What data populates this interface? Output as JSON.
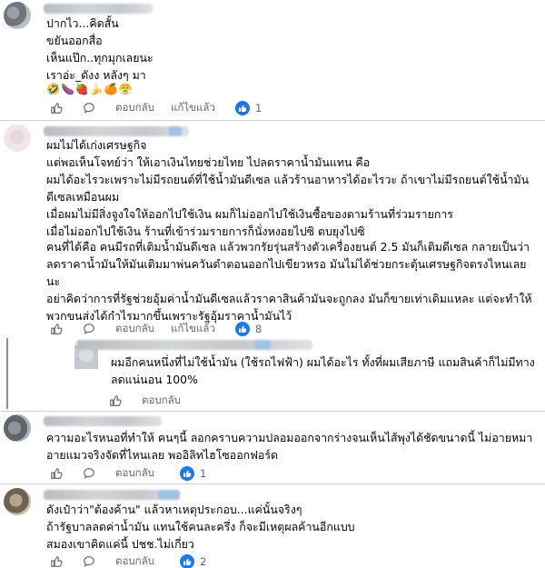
{
  "comments": [
    {
      "text": "ปากไว...คิดสั้น\nขยันออกสื่อ\nเห็นแป๊ก..ทุกมุกเลยนะ\nเราอ่ะ_ดังง หลังๆ มา",
      "emoji": "🤣🍆🍓🍌🍊😤",
      "reply_label": "ตอบกลับ",
      "edited_label": "แก้ไขแล้ว",
      "reaction_count": "1"
    },
    {
      "text": "ผมไม่ได้เก่งเศรษฐกิจ\nแต่พอเห็นโจทย์ว่า ให้เอาเงินไทยช่วยไทย ไปลดราคาน้ำมันแทน คือ\nผมได้อะไรวะเพราะไม่มีรถยนต์ที่ใช้น้ำมันดีเซล แล้วร้านอาหารได้อะไรวะ ถ้าเขาไม่มีรถยนต์ใช้น้ำมันดีเซลเหมือนผม\nเมื่อผมไม่มีสิ่งจูงใจให้ออกไปใช้เงิน ผมก็ไม่ออกไปใช้เงินซื้อของตามร้านที่ร่วมรายการ\nเมื่อไม่ออกไปใช้เงิน ร้านที่เข้าร่วมรายการก็นั่งหงอยไปซิ ตบยุงไปซิ",
      "text2": "คนที่ได้คือ คนมีรถที่เติมน้ำมันดีเซล แล้วพวกรัยรุ่นสร้างตัวเครื่องยนต์ 2.5 มันก็เติมดีเซล กลายเป็นว่าลดราคาน้ำมันให้มันเติมมาพ่นควันดำตอนออกไปเขียวหรอ มันไม่ได้ช่วยกระตุ้นเศรษฐกิจตรงไหนเลยนะ\nอย่าคิดว่าการที่รัฐช่วยอุ้มค่าน้ำมันดีเซลแล้วราคาสินค้ามันจะถูกลง มันก็ขายเท่าเดิมแหละ แต่จะทำให้พวกขนส่งได้กำไรมากขึ้นเพราะรัฐอุ้มราคาน้ำมันไว้",
      "reply_label": "ตอบกลับ",
      "edited_label": "แก้ไขแล้ว",
      "reaction_count": "8"
    },
    {
      "text": "ผมอีกคนหนึ่งที่ไม่ใช้น้ำมัน (ใช้รถไฟฟ้า) ผมได้อะไร ทั้งที่ผมเสียภาษี แถมสินค้าก็ไม่มีทางลดแน่นอน 100%",
      "reply_label": "ตอบกลับ"
    },
    {
      "text": "ความอะไรหนอที่ทำให้ คนๆนี้ ลอกคราบความปลอมออกจากร่างจนเห็นไส้พุงได้ชัดขนาดนี้ ไม่อายหมาอายแมวจริงจัดที่ไหนเลย พออิลิทไฮโซออกฟอร์ด",
      "reply_label": "ตอบกลับ",
      "reaction_count": "1"
    },
    {
      "text": "ดังเป๋าว่า\"ต้องค้าน\" แล้วหาเหตุประกอบ...แค่นั้นจริงๆ\nถ้ารัฐบาลลดค่าน้ำมัน แทนใช้คนละครึ่ง ก็จะมีเหตุผลค้านอีกแบบ\nสมองเขาคิดแค่นี้ ปชช.ไม่เกี่ยว",
      "reply_label": "ตอบกลับ",
      "reaction_count": "2"
    }
  ],
  "colors": {
    "accent": "#1877f2",
    "muted": "#65676b",
    "divider": "#ced0d4",
    "thread": "#7d8fb8"
  },
  "icons": {
    "like": "thumbs-up-icon",
    "comment": "speech-bubble-icon",
    "reaction": "like-reaction-icon"
  }
}
